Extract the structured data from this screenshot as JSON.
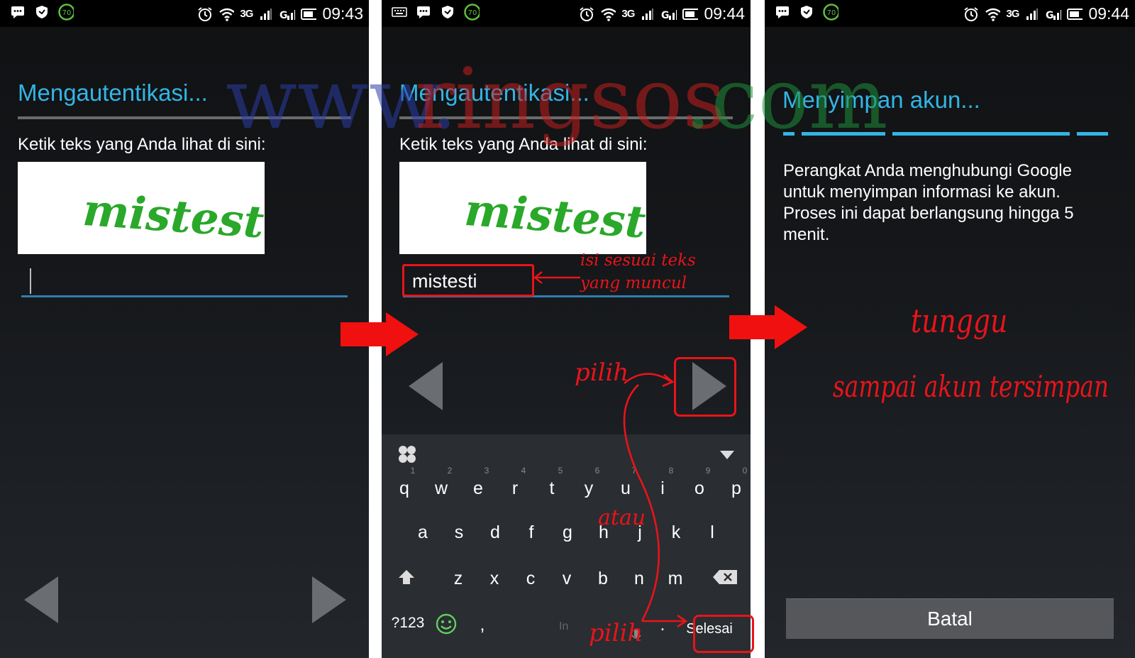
{
  "status": {
    "network": "3G",
    "time_1": "09:43",
    "time_2": "09:44",
    "time_3": "09:44",
    "badge": "70"
  },
  "screen1": {
    "title": "Mengautentikasi...",
    "prompt": "Ketik teks yang Anda lihat di sini:",
    "captcha_text": "mistesti"
  },
  "screen2": {
    "title": "Mengautentikasi...",
    "prompt": "Ketik teks yang Anda lihat di sini:",
    "captcha_text": "mistesti",
    "typed_value": "mistesti",
    "annotations": {
      "fill_hint_1": "isi sesuai teks",
      "fill_hint_2": "yang muncul",
      "choose_1": "pilih",
      "or": "atau",
      "choose_2": "pilih"
    },
    "keyboard": {
      "row1": [
        "q",
        "w",
        "e",
        "r",
        "t",
        "y",
        "u",
        "i",
        "o",
        "p"
      ],
      "row1_numbers": [
        "1",
        "2",
        "3",
        "4",
        "5",
        "6",
        "7",
        "8",
        "9",
        "0"
      ],
      "row2": [
        "a",
        "s",
        "d",
        "f",
        "g",
        "h",
        "j",
        "k",
        "l"
      ],
      "row3": [
        "z",
        "x",
        "c",
        "v",
        "b",
        "n",
        "m"
      ],
      "symbols_key": "?123",
      "comma_key": ",",
      "period_key": ".",
      "space_hint": "In",
      "done_key": "Selesai"
    }
  },
  "screen3": {
    "title": "Menyimpan akun...",
    "info": "Perangkat Anda menghubungi Google untuk menyimpan informasi ke akun. Proses ini dapat berlangsung hingga 5 menit.",
    "annotation_1": "tunggu",
    "annotation_2": "sampai akun tersimpan",
    "cancel_label": "Batal"
  },
  "watermark": {
    "part1": "www.",
    "part2": "ringsos",
    "part3": ".com"
  },
  "colors": {
    "accent": "#33b5e5",
    "annotation_red": "#e8141a",
    "captcha_green": "#2aa82a"
  }
}
